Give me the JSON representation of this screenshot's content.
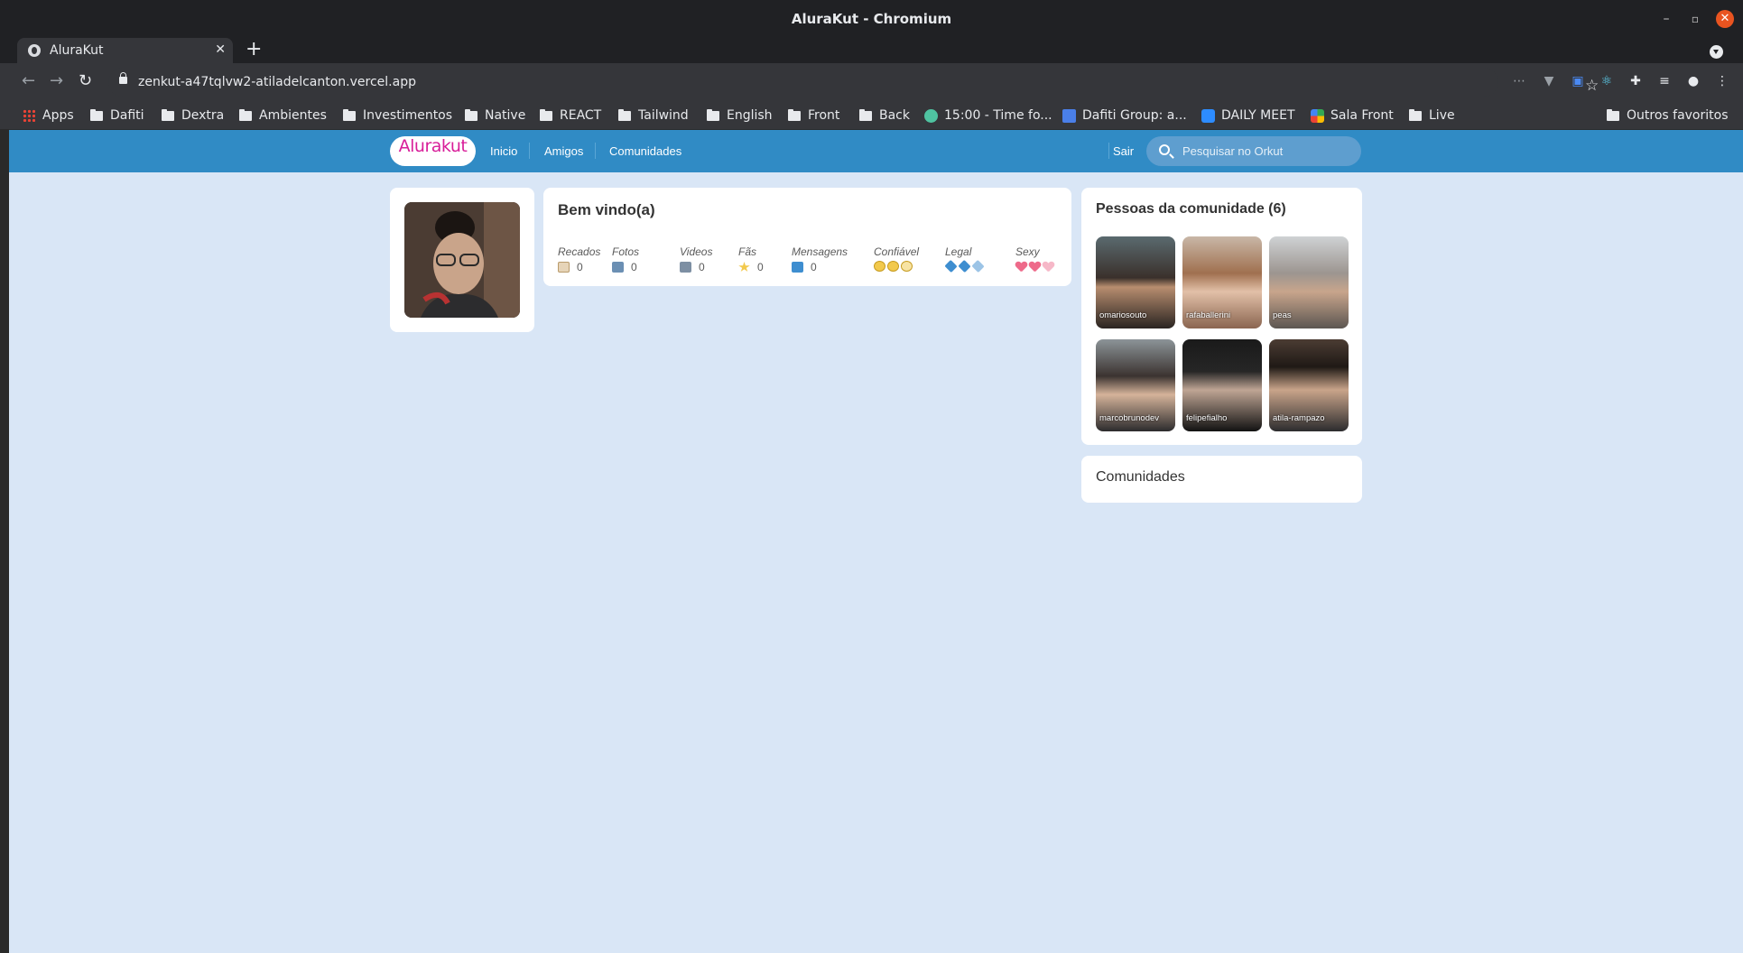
{
  "window": {
    "title": "AluraKut - Chromium"
  },
  "tab": {
    "label": "AluraKut"
  },
  "address_bar": {
    "url": "zenkut-a47tqlvw2-atiladelcanton.vercel.app"
  },
  "bookmarks": [
    "Apps",
    "Dafiti",
    "Dextra",
    "Ambientes",
    "Investimentos",
    "Native",
    "REACT",
    "Tailwind",
    "English",
    "Front",
    "Back",
    "15:00 - Time fo...",
    "Dafiti Group: a...",
    "DAILY MEET",
    "Sala Front",
    "Live",
    "Outros favoritos"
  ],
  "site": {
    "logo": "Alurakut",
    "nav": [
      "Inicio",
      "Amigos",
      "Comunidades"
    ],
    "logout": "Sair",
    "search_placeholder": "Pesquisar no Orkut"
  },
  "welcome": {
    "title": "Bem vindo(a)",
    "stats": [
      {
        "label": "Recados",
        "value": "0",
        "icon": "notes-icon"
      },
      {
        "label": "Fotos",
        "value": "0",
        "icon": "camera-icon"
      },
      {
        "label": "Videos",
        "value": "0",
        "icon": "video-camera-icon"
      },
      {
        "label": "Fãs",
        "value": "0",
        "icon": "star-icon"
      },
      {
        "label": "Mensagens",
        "value": "0",
        "icon": "envelope-icon"
      },
      {
        "label": "Confiável",
        "rating": "smiley-icons"
      },
      {
        "label": "Legal",
        "rating": "ice-cube-icons"
      },
      {
        "label": "Sexy",
        "rating": "heart-icons"
      }
    ]
  },
  "community_people": {
    "title": "Pessoas da comunidade (6)",
    "people": [
      "omariosouto",
      "rafaballerini",
      "peas",
      "marcobrunodev",
      "felipefialho",
      "atila-rampazo"
    ]
  },
  "communities": {
    "title": "Comunidades"
  },
  "colors": {
    "topbar": "#308bc5",
    "background": "#d9e6f6",
    "logo": "#d81d99"
  }
}
